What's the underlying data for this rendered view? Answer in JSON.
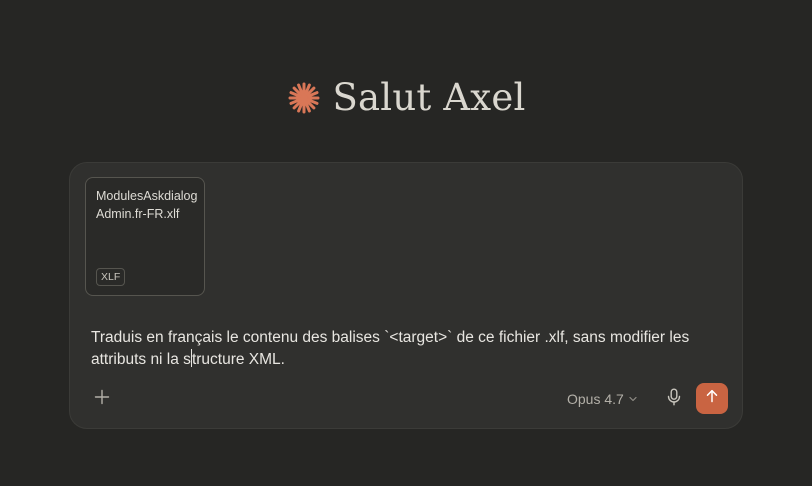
{
  "greeting": {
    "text": "Salut Axel",
    "logo_icon": "claude-sparkle-icon",
    "logo_color": "#d97757"
  },
  "composer": {
    "attachment": {
      "file_name": "ModulesAskdialogAdmin.fr-FR.xlf",
      "file_type": "XLF"
    },
    "message_before_caret": "Traduis en français le contenu des balises `<target>` de ce fichier .xlf, sans modifier les attributs ni la s",
    "message_after_caret": "tructure XML.",
    "add_icon": "plus-icon",
    "model_label": "Opus 4.7",
    "model_icon": "chevron-down-icon",
    "mic_icon": "microphone-icon",
    "send_icon": "arrow-up-icon",
    "send_color": "#c96442"
  }
}
